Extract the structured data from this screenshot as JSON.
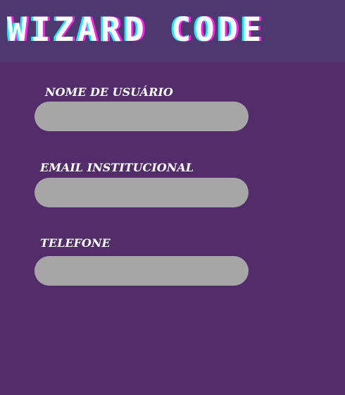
{
  "header": {
    "logo_text": "WIZARD CODE",
    "background": "#4e3870"
  },
  "page": {
    "background": "#522d69"
  },
  "form": {
    "username": {
      "label": "NOME DE USUÁRIO",
      "value": ""
    },
    "email": {
      "label": "EMAIL INSTITUCIONAL",
      "value": ""
    },
    "phone": {
      "label": "TELEFONE",
      "value": ""
    }
  },
  "colors": {
    "field_fill": "#a6a6a6",
    "logo_cyan": "#1ee6f0",
    "logo_magenta": "#ff22e6",
    "label_text": "#ffffff"
  }
}
